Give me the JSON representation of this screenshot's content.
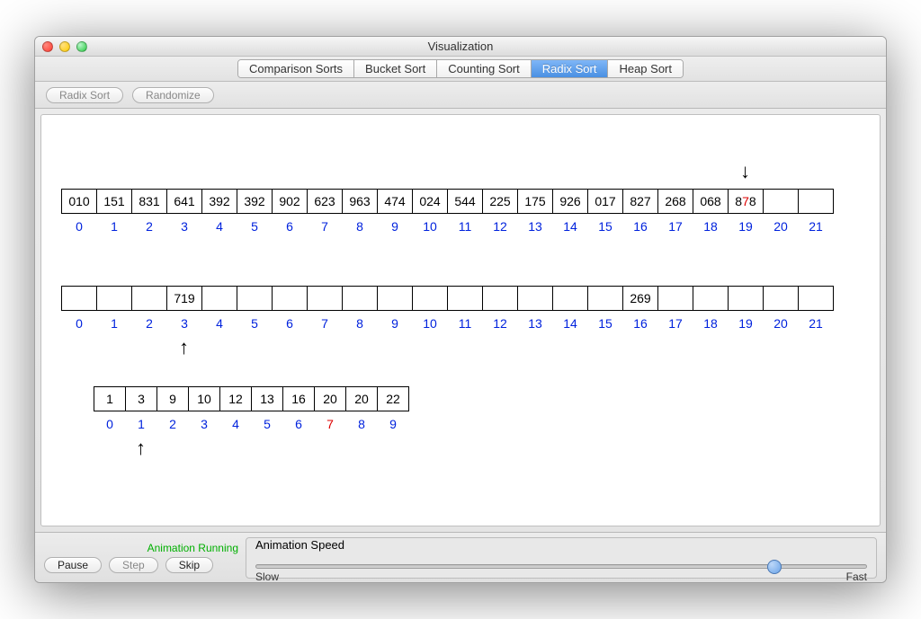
{
  "window": {
    "title": "Visualization"
  },
  "tabs": {
    "items": [
      "Comparison Sorts",
      "Bucket Sort",
      "Counting Sort",
      "Radix Sort",
      "Heap Sort"
    ],
    "active_index": 3
  },
  "toolbar": {
    "radix_sort_label": "Radix Sort",
    "randomize_label": "Randomize"
  },
  "array1": {
    "cells": [
      "010",
      "151",
      "831",
      "641",
      "392",
      "392",
      "902",
      "623",
      "963",
      "474",
      "024",
      "544",
      "225",
      "175",
      "926",
      "017",
      "827",
      "268",
      "068",
      "878",
      "",
      ""
    ],
    "highlight_cell_index": 19,
    "highlight_digit_index": 1,
    "indices": [
      "0",
      "1",
      "2",
      "3",
      "4",
      "5",
      "6",
      "7",
      "8",
      "9",
      "10",
      "11",
      "12",
      "13",
      "14",
      "15",
      "16",
      "17",
      "18",
      "19",
      "20",
      "21"
    ],
    "arrow_index": 19
  },
  "array2": {
    "cells": [
      "",
      "",
      "",
      "719",
      "",
      "",
      "",
      "",
      "",
      "",
      "",
      "",
      "",
      "",
      "",
      "",
      "269",
      "",
      "",
      "",
      "",
      ""
    ],
    "indices": [
      "0",
      "1",
      "2",
      "3",
      "4",
      "5",
      "6",
      "7",
      "8",
      "9",
      "10",
      "11",
      "12",
      "13",
      "14",
      "15",
      "16",
      "17",
      "18",
      "19",
      "20",
      "21"
    ],
    "arrow_index": 3
  },
  "array3": {
    "cells": [
      "1",
      "3",
      "9",
      "10",
      "12",
      "13",
      "16",
      "20",
      "20",
      "22"
    ],
    "indices": [
      "0",
      "1",
      "2",
      "3",
      "4",
      "5",
      "6",
      "7",
      "8",
      "9"
    ],
    "red_index": 7,
    "arrow_index": 1,
    "offset_cells": 1
  },
  "controls": {
    "status": "Animation Running",
    "pause_label": "Pause",
    "step_label": "Step",
    "skip_label": "Skip"
  },
  "speed": {
    "legend": "Animation Speed",
    "slow_label": "Slow",
    "fast_label": "Fast",
    "value_percent": 85
  }
}
